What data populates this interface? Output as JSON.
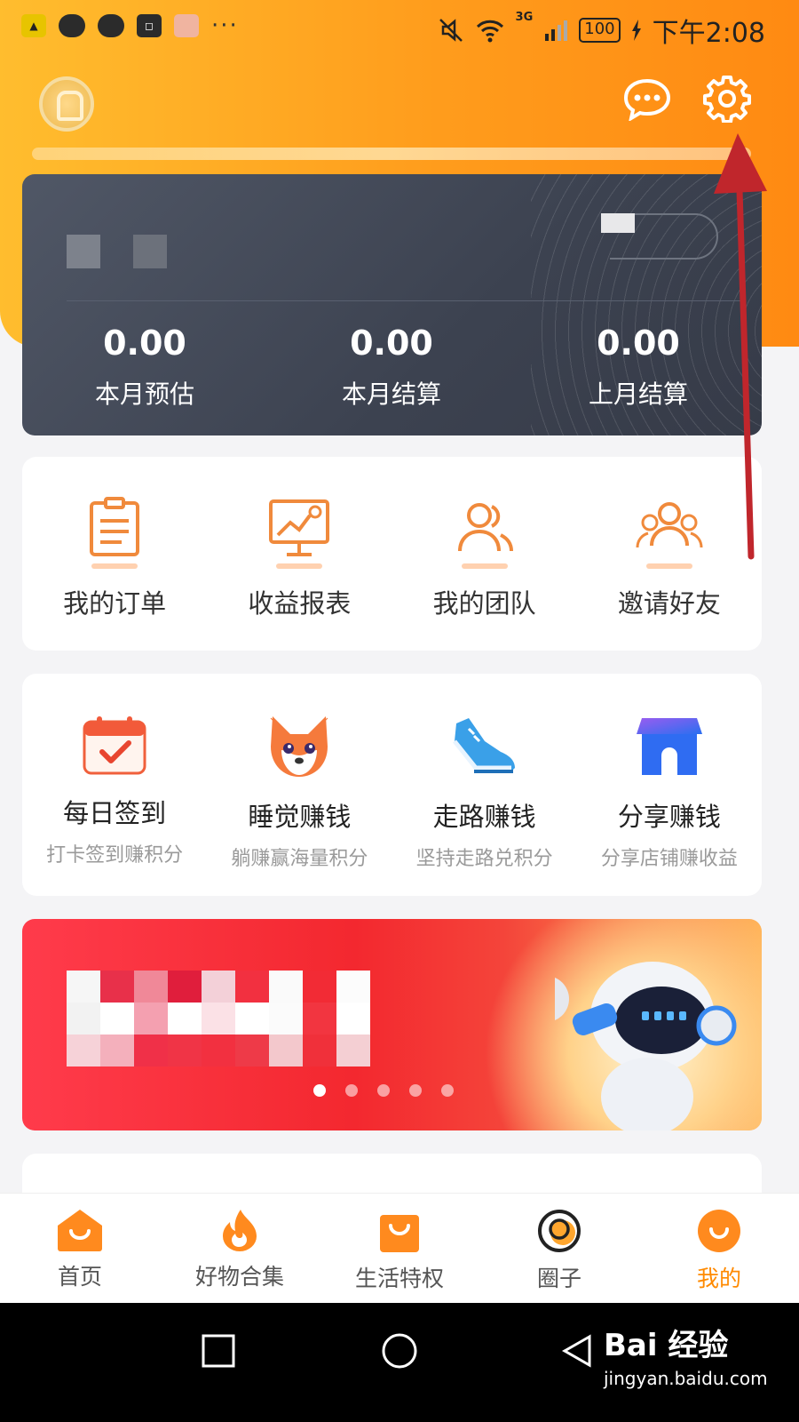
{
  "status_bar": {
    "time": "下午2:08",
    "battery": "100",
    "network": "3G",
    "more": "···"
  },
  "header": {
    "message_icon": "chat-bubble-icon",
    "settings_icon": "gear-icon"
  },
  "earnings": {
    "stats": [
      {
        "value": "0.00",
        "label": "本月预估"
      },
      {
        "value": "0.00",
        "label": "本月结算"
      },
      {
        "value": "0.00",
        "label": "上月结算"
      }
    ]
  },
  "tools": [
    {
      "label": "我的订单",
      "icon": "order-list-icon"
    },
    {
      "label": "收益报表",
      "icon": "report-chart-icon"
    },
    {
      "label": "我的团队",
      "icon": "team-icon"
    },
    {
      "label": "邀请好友",
      "icon": "invite-friends-icon"
    }
  ],
  "earn": [
    {
      "label": "每日签到",
      "sub": "打卡签到赚积分",
      "icon": "calendar-check-icon"
    },
    {
      "label": "睡觉赚钱",
      "sub": "躺赚赢海量积分",
      "icon": "fox-icon"
    },
    {
      "label": "走路赚钱",
      "sub": "坚持走路兑积分",
      "icon": "sneaker-icon"
    },
    {
      "label": "分享赚钱",
      "sub": "分享店铺赚收益",
      "icon": "shop-icon"
    }
  ],
  "banner": {
    "slides": 5,
    "active": 0
  },
  "tabbar": [
    {
      "label": "首页",
      "icon": "home-bag-icon",
      "active": false
    },
    {
      "label": "好物合集",
      "icon": "flame-icon",
      "active": false
    },
    {
      "label": "生活特权",
      "icon": "shopping-bag-icon",
      "active": false
    },
    {
      "label": "圈子",
      "icon": "circle-icon",
      "active": false
    },
    {
      "label": "我的",
      "icon": "profile-smile-icon",
      "active": true
    }
  ],
  "watermark": {
    "brand": "Bai 经验",
    "url": "jingyan.baidu.com"
  },
  "colors": {
    "accent": "#ff8a00",
    "arrow": "#c0262c",
    "wallet_bg": "#434957"
  }
}
